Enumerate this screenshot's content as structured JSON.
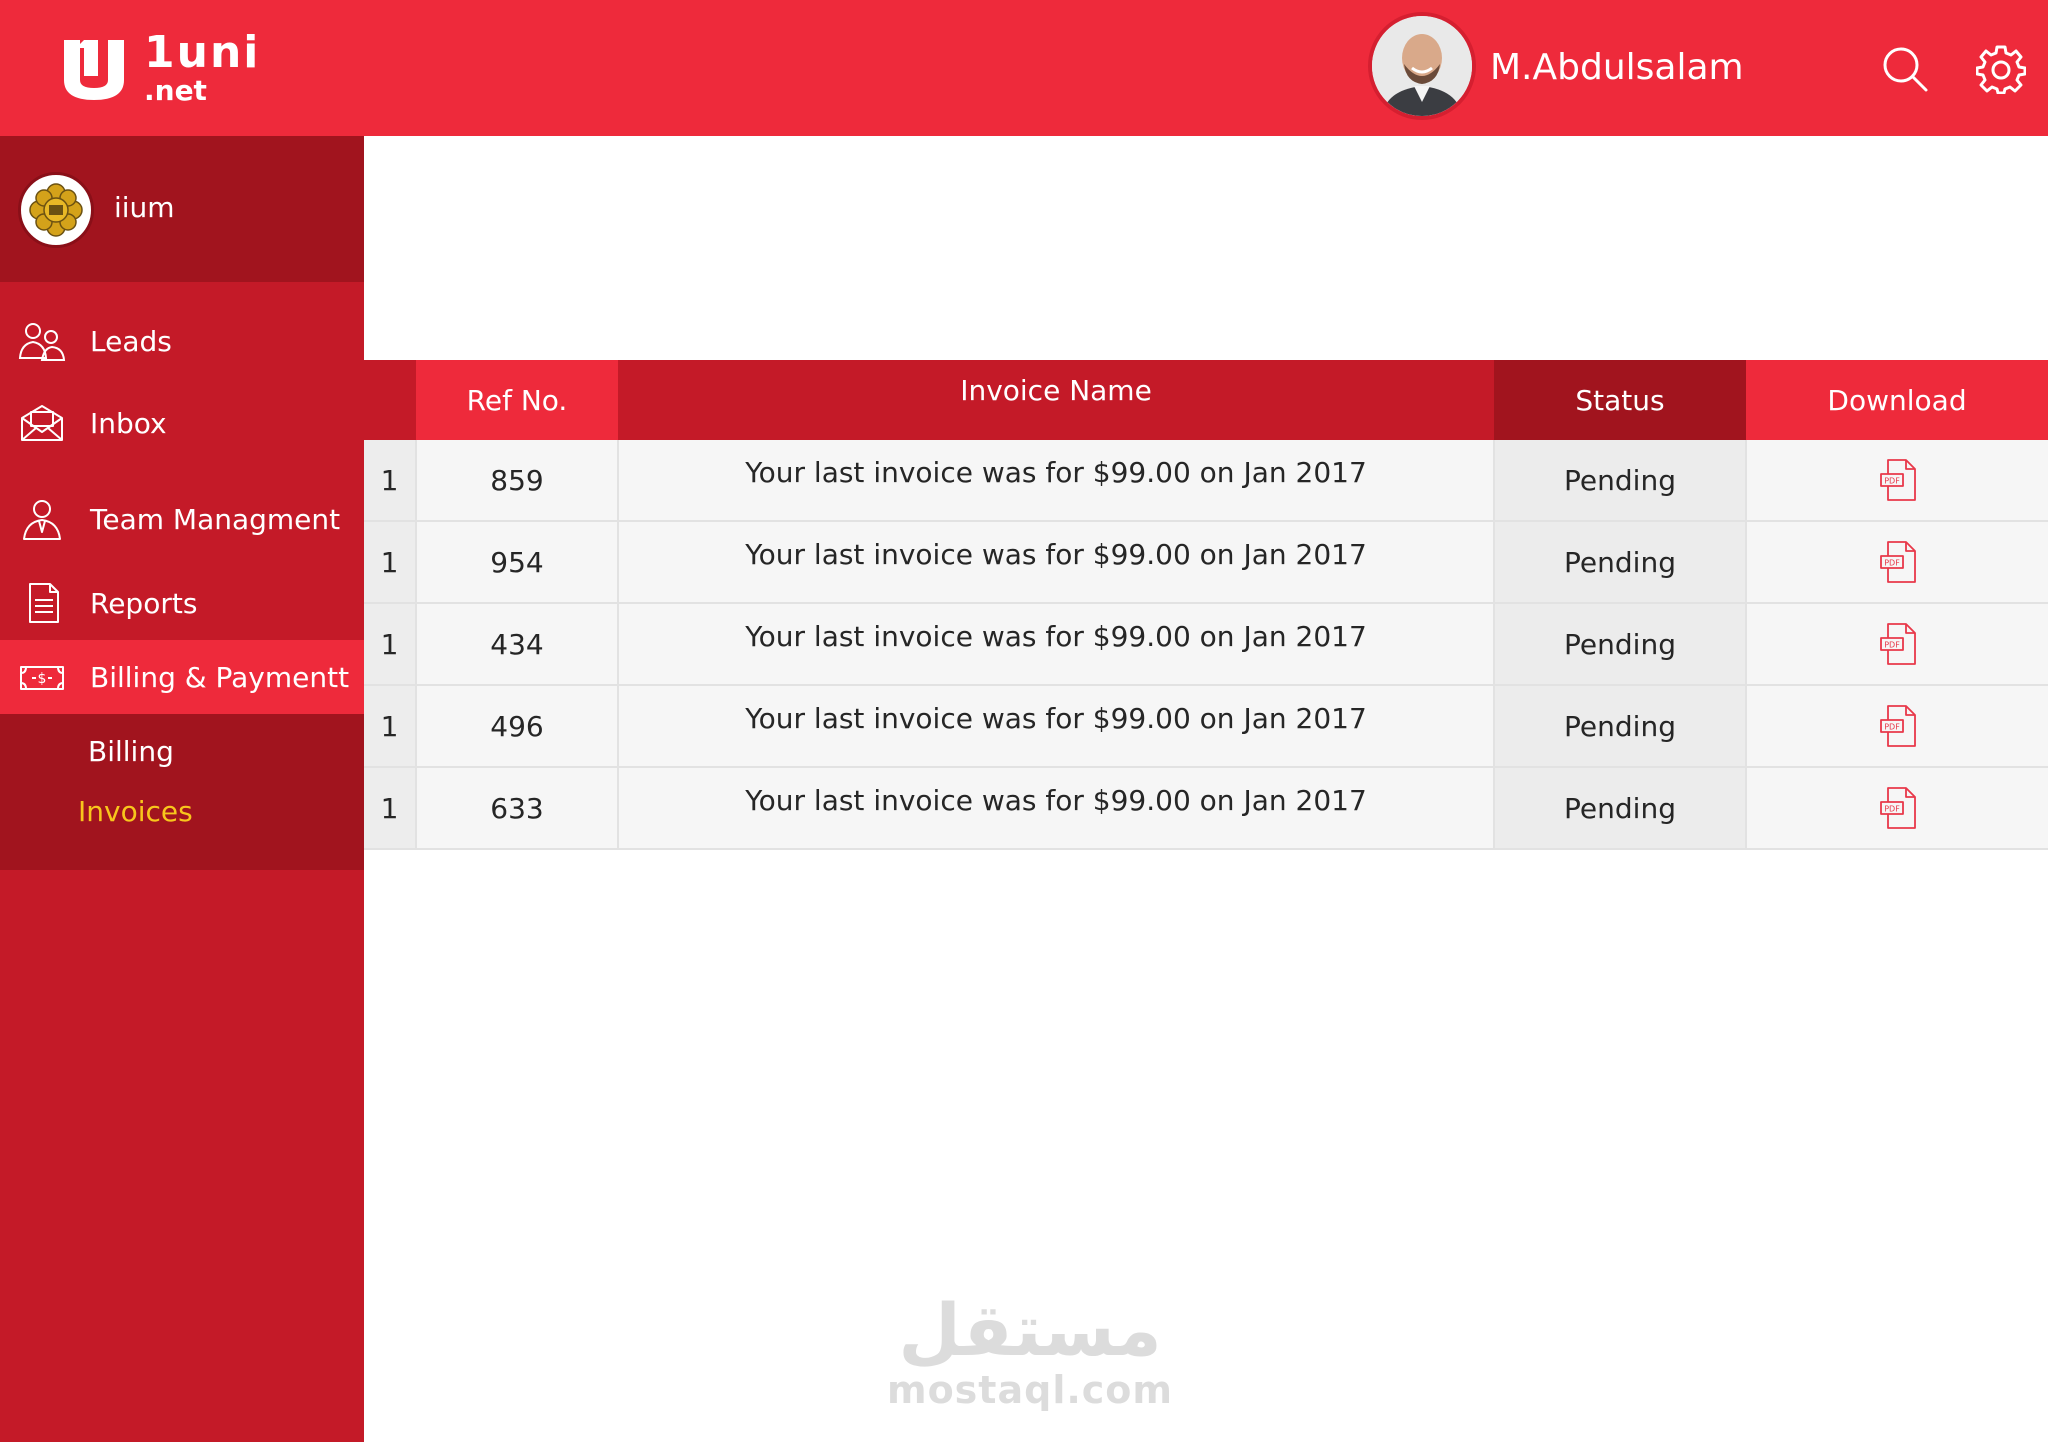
{
  "header": {
    "logo_text": "1uni",
    "logo_sub": ".net",
    "user_name": "M.Abdulsalam",
    "icons": [
      "search-icon",
      "gear-icon"
    ]
  },
  "sidebar": {
    "org_name": "iium",
    "items": [
      {
        "label": "Leads",
        "icon": "users-icon"
      },
      {
        "label": "Inbox",
        "icon": "envelope-icon"
      },
      {
        "label": "Team Managment",
        "icon": "user-tie-icon"
      },
      {
        "label": "Reports",
        "icon": "document-icon"
      },
      {
        "label": "Billing & Paymentt",
        "icon": "money-icon",
        "active": true
      }
    ],
    "submenu": [
      {
        "label": "Billing"
      },
      {
        "label": "Invoices",
        "active": true
      }
    ]
  },
  "table": {
    "headers": {
      "idx": "",
      "ref": "Ref No.",
      "name": "Invoice Name",
      "status": "Status",
      "download": "Download"
    },
    "rows": [
      {
        "idx": "1",
        "ref": "859",
        "name": "Your last invoice was for $99.00 on Jan 2017",
        "status": "Pending"
      },
      {
        "idx": "1",
        "ref": "954",
        "name": "Your last invoice was for $99.00 on Jan 2017",
        "status": "Pending"
      },
      {
        "idx": "1",
        "ref": "434",
        "name": "Your last invoice was for $99.00 on Jan 2017",
        "status": "Pending"
      },
      {
        "idx": "1",
        "ref": "496",
        "name": "Your last invoice was for $99.00 on Jan 2017",
        "status": "Pending"
      },
      {
        "idx": "1",
        "ref": "633",
        "name": "Your last invoice was for $99.00 on Jan 2017",
        "status": "Pending"
      }
    ]
  },
  "watermark": {
    "arabic": "مستقل",
    "latin": "mostaql.com"
  },
  "colors": {
    "brand_red": "#ee2a3b",
    "sidebar_red": "#c41a28",
    "dark_red": "#a1141e",
    "active_sub": "#f8c61c"
  }
}
